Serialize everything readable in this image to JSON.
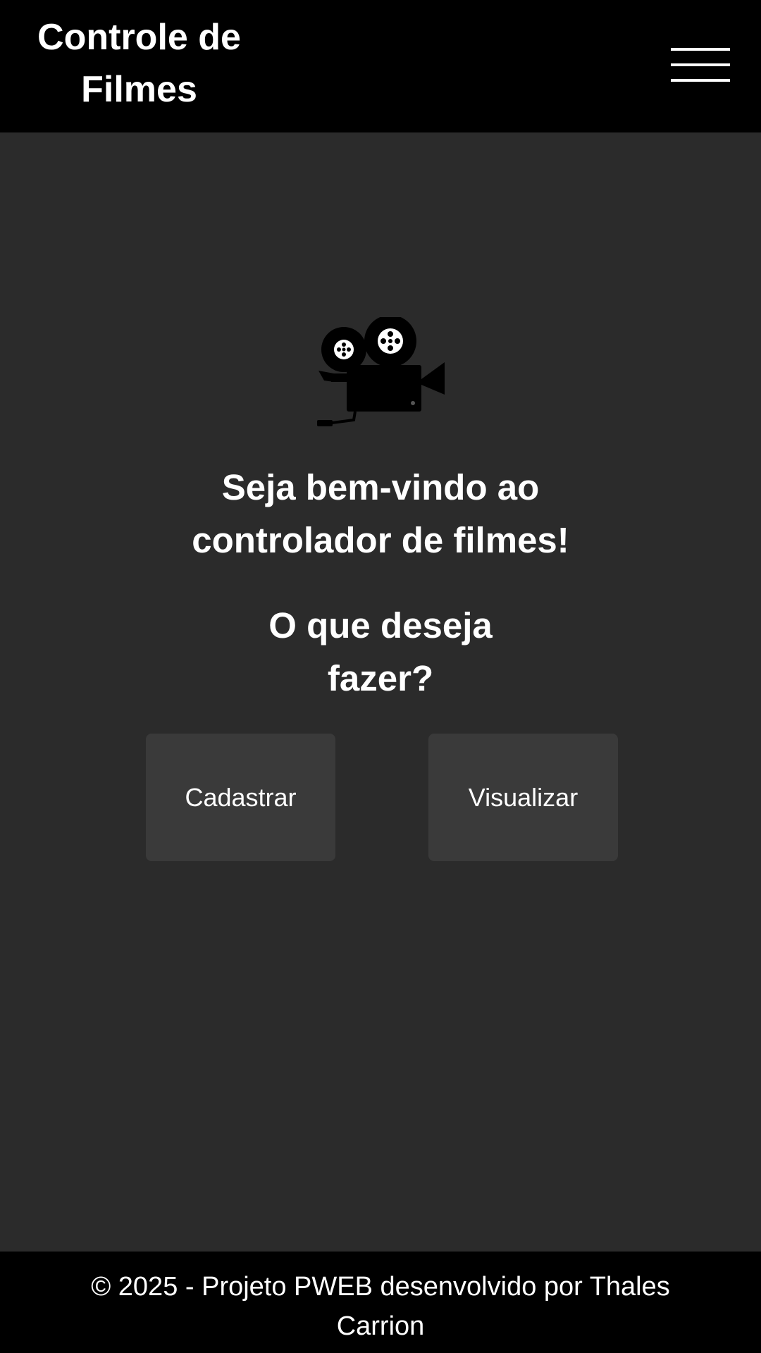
{
  "header": {
    "title": "Controle de Filmes",
    "menu_icon": "hamburger-menu-icon"
  },
  "main": {
    "hero_icon": "movie-camera-icon",
    "welcome_text": "Seja bem-vindo ao controlador de filmes!",
    "question_text": "O que deseja fazer?",
    "buttons": [
      {
        "label": "Cadastrar"
      },
      {
        "label": "Visualizar"
      }
    ]
  },
  "footer": {
    "text": "© 2025 - Projeto PWEB desenvolvido por Thales Carrion"
  },
  "colors": {
    "background": "#2b2b2b",
    "header_footer": "#000000",
    "button": "#3a3a3a",
    "text": "#ffffff"
  }
}
